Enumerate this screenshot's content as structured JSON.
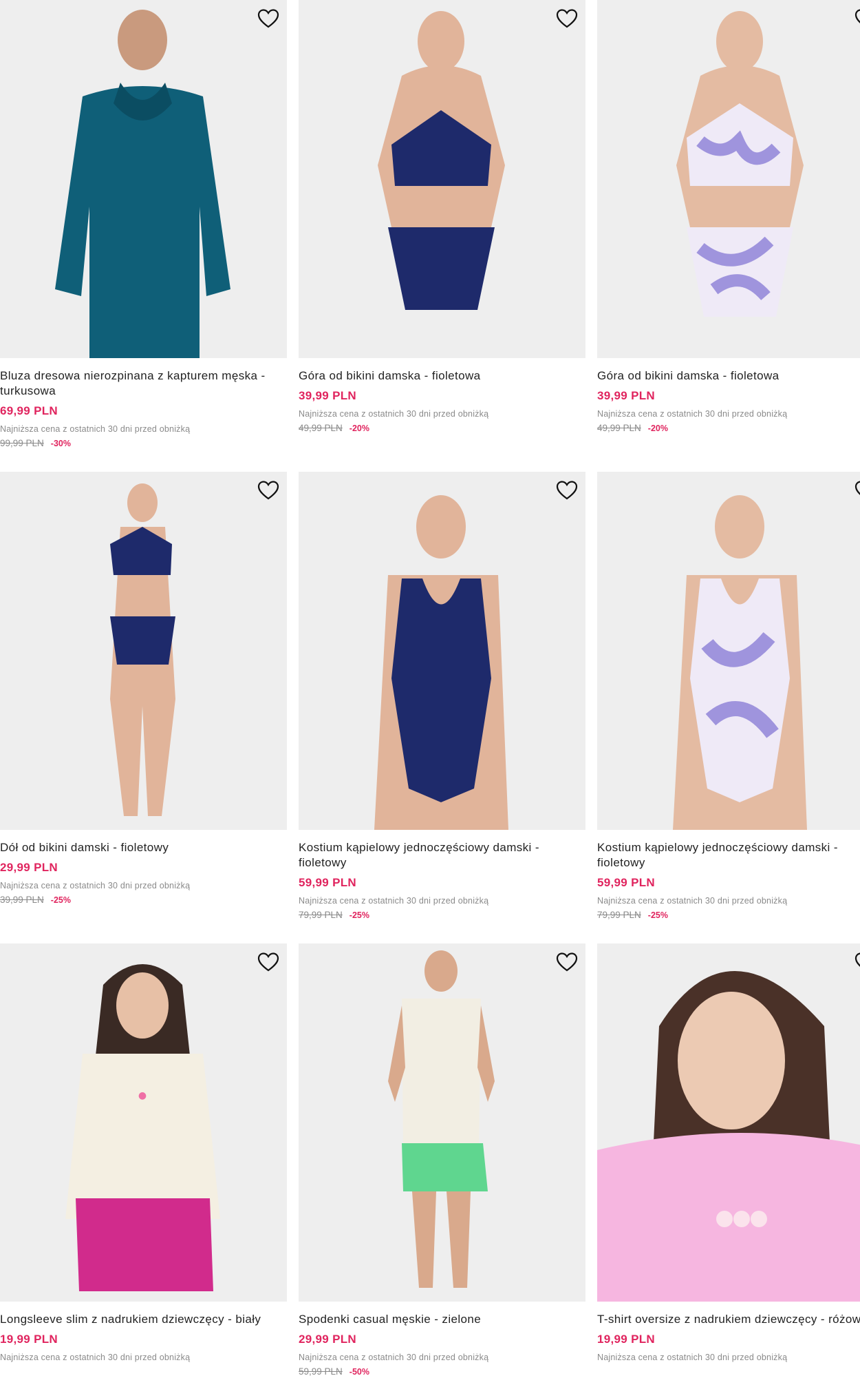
{
  "icons": {
    "favorite": "heart-outline-icon"
  },
  "colors": {
    "accent": "#e0245e",
    "muted": "#8a8a8a",
    "image_bg": "#eeeeee"
  },
  "products": [
    {
      "name": "Bluza dresowa nierozpinana z kapturem męska - turkusowa",
      "price": "69,99 PLN",
      "lowest_note": "Najniższa cena z ostatnich 30 dni przed obniżką",
      "old_price": "99,99 PLN",
      "discount": "-30%"
    },
    {
      "name": "Góra od bikini damska - fioletowa",
      "price": "39,99 PLN",
      "lowest_note": "Najniższa cena z ostatnich 30 dni przed obniżką",
      "old_price": "49,99 PLN",
      "discount": "-20%"
    },
    {
      "name": "Góra od bikini damska - fioletowa",
      "price": "39,99 PLN",
      "lowest_note": "Najniższa cena z ostatnich 30 dni przed obniżką",
      "old_price": "49,99 PLN",
      "discount": "-20%"
    },
    {
      "name": "Dół od bikini damski - fioletowy",
      "price": "29,99 PLN",
      "lowest_note": "Najniższa cena z ostatnich 30 dni przed obniżką",
      "old_price": "39,99 PLN",
      "discount": "-25%"
    },
    {
      "name": "Kostium kąpielowy jednoczęściowy damski - fioletowy",
      "price": "59,99 PLN",
      "lowest_note": "Najniższa cena z ostatnich 30 dni przed obniżką",
      "old_price": "79,99 PLN",
      "discount": "-25%"
    },
    {
      "name": "Kostium kąpielowy jednoczęściowy damski - fioletowy",
      "price": "59,99 PLN",
      "lowest_note": "Najniższa cena z ostatnich 30 dni przed obniżką",
      "old_price": "79,99 PLN",
      "discount": "-25%"
    },
    {
      "name": "Longsleeve slim z nadrukiem dziewczęcy - biały",
      "price": "19,99 PLN",
      "lowest_note": "Najniższa cena z ostatnich 30 dni przed obniżką",
      "old_price": "",
      "discount": ""
    },
    {
      "name": "Spodenki casual męskie - zielone",
      "price": "29,99 PLN",
      "lowest_note": "Najniższa cena z ostatnich 30 dni przed obniżką",
      "old_price": "59,99 PLN",
      "discount": "-50%"
    },
    {
      "name": "T-shirt oversize z nadrukiem dziewczęcy - różowy",
      "price": "19,99 PLN",
      "lowest_note": "Najniższa cena z ostatnich 30 dni przed obniżką",
      "old_price": "",
      "discount": ""
    }
  ]
}
